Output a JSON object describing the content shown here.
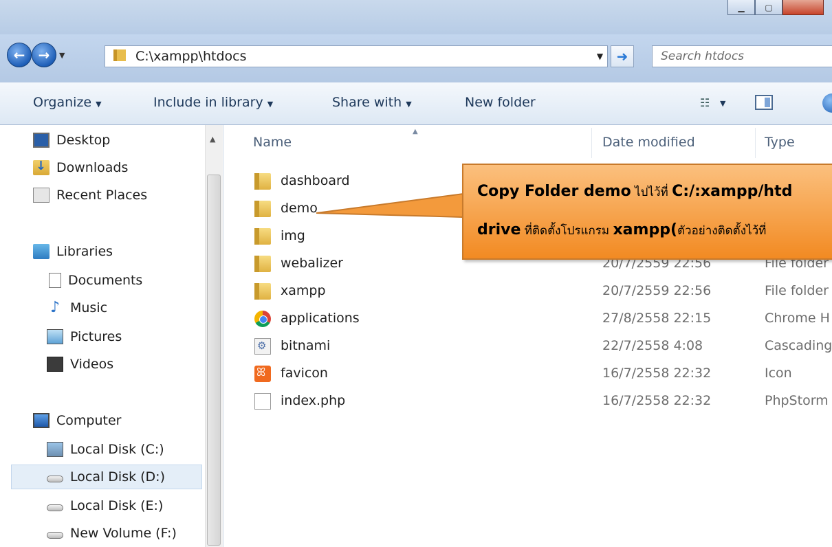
{
  "window": {
    "min_label": "▁",
    "max_label": "▢",
    "close_label": ""
  },
  "address": {
    "path": "C:\\xampp\\htdocs",
    "search_placeholder": "Search htdocs"
  },
  "toolbar": {
    "organize": "Organize",
    "include_in_library": "Include in library",
    "share_with": "Share with",
    "new_folder": "New folder"
  },
  "nav": {
    "favorites": [
      {
        "label": "Desktop",
        "icon": "desktop-icon"
      },
      {
        "label": "Downloads",
        "icon": "downloads-icon"
      },
      {
        "label": "Recent Places",
        "icon": "recent-places-icon"
      }
    ],
    "libraries_label": "Libraries",
    "libraries": [
      {
        "label": "Documents",
        "icon": "documents-icon"
      },
      {
        "label": "Music",
        "icon": "music-icon"
      },
      {
        "label": "Pictures",
        "icon": "pictures-icon"
      },
      {
        "label": "Videos",
        "icon": "videos-icon"
      }
    ],
    "computer_label": "Computer",
    "drives": [
      {
        "label": "Local Disk (C:)",
        "icon": "system-drive-icon"
      },
      {
        "label": "Local Disk (D:)",
        "icon": "drive-icon",
        "selected": true
      },
      {
        "label": "Local Disk (E:)",
        "icon": "drive-icon"
      },
      {
        "label": "New Volume (F:)",
        "icon": "drive-icon"
      }
    ]
  },
  "columns": {
    "name": "Name",
    "date_modified": "Date modified",
    "type": "Type"
  },
  "files": [
    {
      "name": "dashboard",
      "date": "",
      "type": "",
      "icon": "folder-icon"
    },
    {
      "name": "demo",
      "date": "",
      "type": "",
      "icon": "folder-icon"
    },
    {
      "name": "img",
      "date": "",
      "type": "",
      "icon": "folder-icon"
    },
    {
      "name": "webalizer",
      "date": "20/7/2559 22:56",
      "type": "File folder",
      "icon": "folder-icon"
    },
    {
      "name": "xampp",
      "date": "20/7/2559 22:56",
      "type": "File folder",
      "icon": "folder-icon"
    },
    {
      "name": "applications",
      "date": "27/8/2558 22:15",
      "type": "Chrome H",
      "icon": "chrome-icon"
    },
    {
      "name": "bitnami",
      "date": "22/7/2558 4:08",
      "type": "Cascading",
      "icon": "css-file-icon"
    },
    {
      "name": "favicon",
      "date": "16/7/2558 22:32",
      "type": "Icon",
      "icon": "xampp-icon"
    },
    {
      "name": "index.php",
      "date": "16/7/2558 22:32",
      "type": "PhpStorm",
      "icon": "file-icon"
    }
  ],
  "callout": {
    "line1_bold": "Copy Folder demo",
    "line1_thai": " ไปไว้ที่ ",
    "line1_path": "C:/:xampp/htd",
    "line2_bold": "drive",
    "line2_thai": " ที่ติดตั้งโปรแกรม ",
    "line2_bold2": "xampp(",
    "line2_thai2": "ตัวอย่างติดตั้งไว้ที่"
  },
  "colors": {
    "callout_fill": "#f59a3a",
    "address_bar": "#c3d6ee",
    "selected_drive": "#e4eef8"
  }
}
